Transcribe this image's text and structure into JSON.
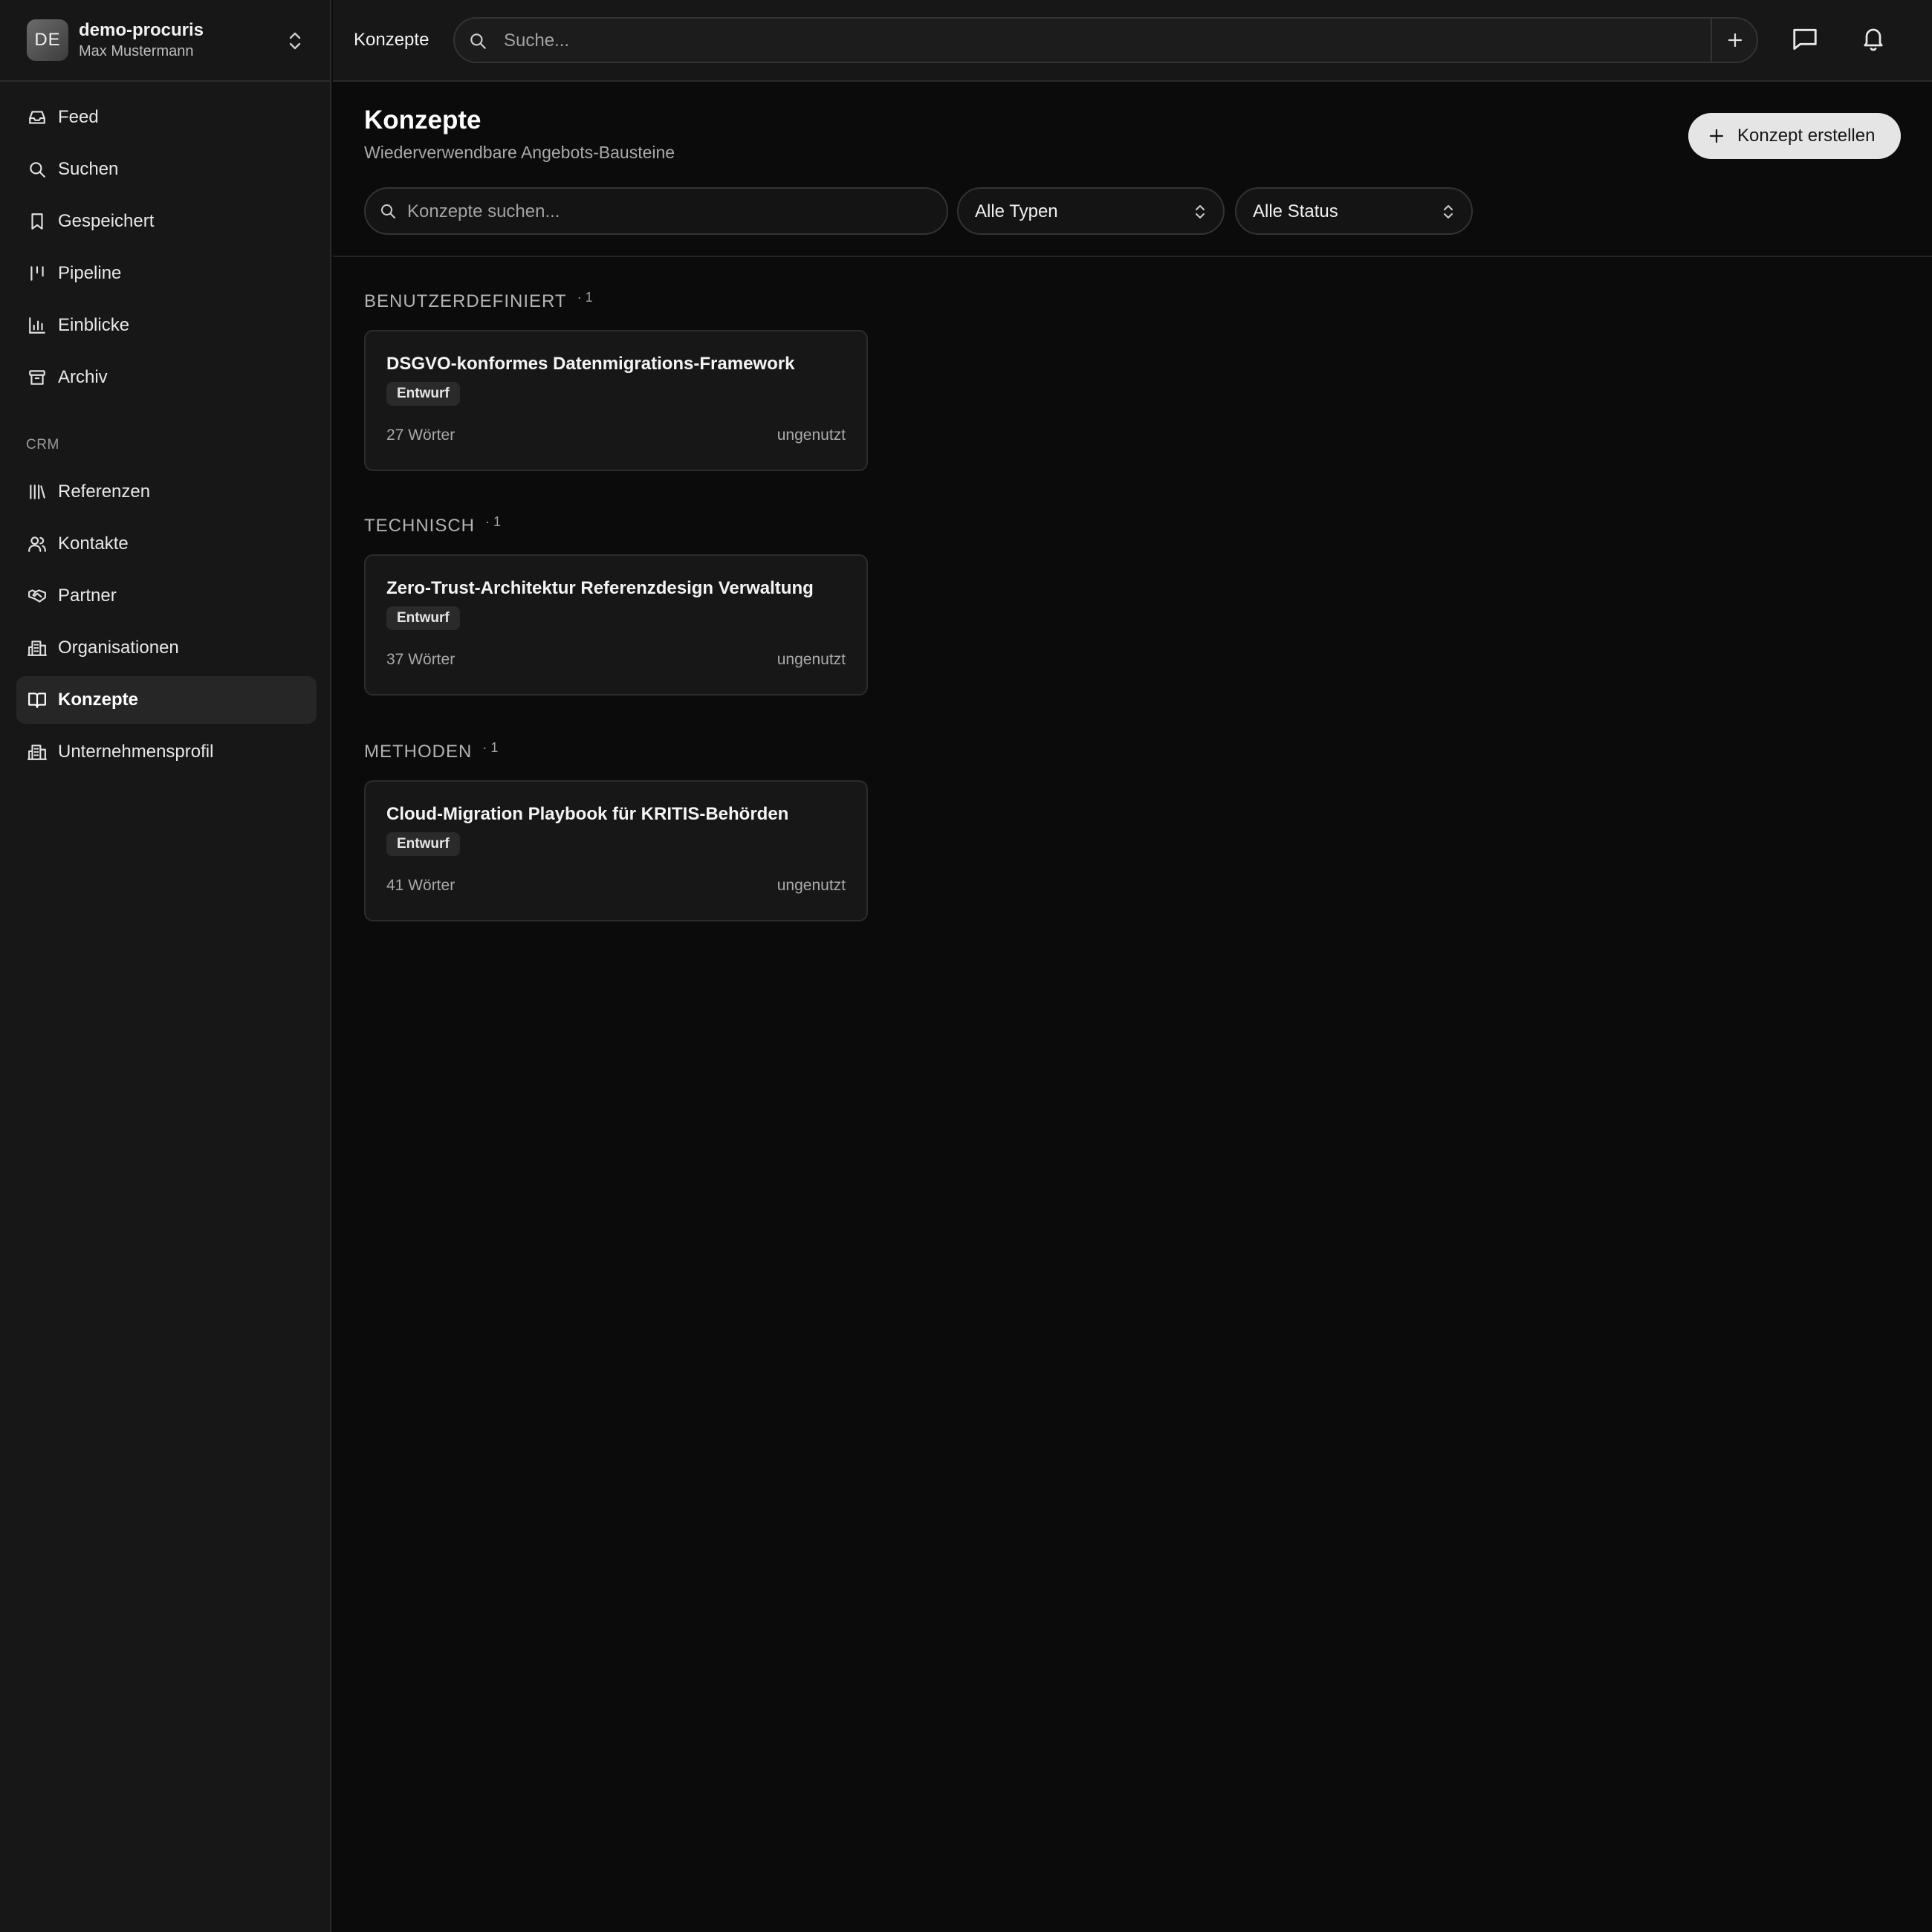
{
  "workspace": {
    "initials": "DE",
    "name": "demo-procuris",
    "user": "Max Mustermann"
  },
  "sidebar": {
    "items": [
      {
        "label": "Feed",
        "icon": "inbox-icon"
      },
      {
        "label": "Suchen",
        "icon": "search-icon"
      },
      {
        "label": "Gespeichert",
        "icon": "bookmark-icon"
      },
      {
        "label": "Pipeline",
        "icon": "pipeline-icon"
      },
      {
        "label": "Einblicke",
        "icon": "bar-chart-icon"
      },
      {
        "label": "Archiv",
        "icon": "archive-icon"
      }
    ],
    "section_label": "CRM",
    "crm_items": [
      {
        "label": "Referenzen",
        "icon": "library-icon"
      },
      {
        "label": "Kontakte",
        "icon": "users-icon"
      },
      {
        "label": "Partner",
        "icon": "handshake-icon"
      },
      {
        "label": "Organisationen",
        "icon": "building-icon"
      },
      {
        "label": "Konzepte",
        "icon": "book-open-icon",
        "active": true
      },
      {
        "label": "Unternehmensprofil",
        "icon": "building-icon"
      }
    ]
  },
  "topbar": {
    "breadcrumb": "Konzepte",
    "search_placeholder": "Suche..."
  },
  "page": {
    "title": "Konzepte",
    "subtitle": "Wiederverwendbare Angebots-Bausteine",
    "create_label": "Konzept erstellen",
    "search_placeholder": "Konzepte suchen...",
    "type_filter": "Alle Typen",
    "status_filter": "Alle Status"
  },
  "groups": [
    {
      "name": "BENUTZERDEFINIERT",
      "count": "· 1",
      "card": {
        "title": "DSGVO-konformes Datenmigrations-Framework",
        "status": "Entwurf",
        "words": "27 Wörter",
        "usage": "ungenutzt"
      }
    },
    {
      "name": "TECHNISCH",
      "count": "· 1",
      "card": {
        "title": "Zero-Trust-Architektur Referenzdesign Verwaltung",
        "status": "Entwurf",
        "words": "37 Wörter",
        "usage": "ungenutzt"
      }
    },
    {
      "name": "METHODEN",
      "count": "· 1",
      "card": {
        "title": "Cloud-Migration Playbook für KRITIS-Behörden",
        "status": "Entwurf",
        "words": "41 Wörter",
        "usage": "ungenutzt"
      }
    }
  ],
  "colors": {
    "background": "#0b0b0b",
    "sidebar": "#171717",
    "accent_button": "#e5e5e5",
    "active_nav": "#262626"
  }
}
